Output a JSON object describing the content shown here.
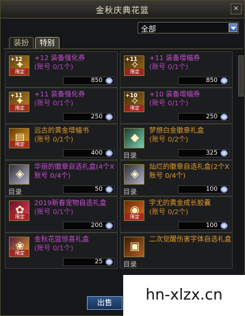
{
  "window": {
    "title": "金秋庆典花篮",
    "close_label": "×"
  },
  "filter": {
    "value": "全部"
  },
  "tabs": [
    {
      "label": "装扮"
    },
    {
      "label": "特别"
    }
  ],
  "items": [
    {
      "name": "+12 装备强化券",
      "limit": "(账号 0/1个)",
      "price": "850",
      "icon": "enhance-ticket-icon",
      "icon_text": "+12",
      "tag": "限定",
      "list_label": ""
    },
    {
      "name": "+11 装备增幅券",
      "limit": "(账号 0/1个)",
      "price": "850",
      "icon": "amplify-ticket-icon",
      "icon_text": "+11",
      "tag": "限定",
      "list_label": ""
    },
    {
      "name": "+11 装备强化券",
      "limit": "(账号 0/1个)",
      "price": "250",
      "icon": "enhance-ticket-icon",
      "icon_text": "+11",
      "tag": "限定",
      "list_label": ""
    },
    {
      "name": "+10 装备增幅券",
      "limit": "(账号 0/1个)",
      "price": "250",
      "icon": "amplify-ticket-icon",
      "icon_text": "+10",
      "tag": "限定",
      "list_label": ""
    },
    {
      "name": "远古的黄金增幅书",
      "limit": "(账号 0/1个)",
      "price": "400",
      "icon": "golden-book-icon",
      "icon_text": "",
      "tag": "限定",
      "list_label": ""
    },
    {
      "name": "梦想白金徽章礼盒",
      "limit": "(账号 0/2个)",
      "price": "325",
      "icon": "platinum-emblem-box-icon",
      "icon_text": "",
      "tag": "",
      "list_label": "目录"
    },
    {
      "name": "华丽的徽章自选礼盒(4个X账号 0/4个)",
      "limit": "",
      "price": "50",
      "icon": "emblem-box-icon",
      "icon_text": "",
      "tag": "",
      "list_label": "目录"
    },
    {
      "name": "灿烂的徽章自选礼盒(2个X账号 0/4个)",
      "limit": "",
      "price": "100",
      "icon": "emblem-box-icon",
      "icon_text": "",
      "tag": "",
      "list_label": "目录"
    },
    {
      "name": "2019新春宠物自选礼盒",
      "limit": "(账号 0/1个)",
      "price": "200",
      "icon": "pet-box-icon",
      "icon_text": "",
      "tag": "限定",
      "list_label": ""
    },
    {
      "name": "宇尤的黄金成长胶囊",
      "limit": "(账号 0/2个)",
      "price": "100",
      "icon": "growth-capsule-icon",
      "icon_text": "",
      "tag": "限定",
      "list_label": ""
    },
    {
      "name": "金秋花篮惊喜礼盒",
      "limit": "(账号 0/1个)",
      "price": "25",
      "icon": "surprise-box-icon",
      "icon_text": "",
      "tag": "限定",
      "list_label": ""
    },
    {
      "name": "二次觉醒伤害字体自选礼盒",
      "limit": "",
      "price": "",
      "icon": "damage-font-box-icon",
      "icon_text": "",
      "tag": "",
      "list_label": "目录"
    }
  ],
  "buttons": {
    "out": "出售"
  },
  "watermark": "hn-xlzx.cn"
}
